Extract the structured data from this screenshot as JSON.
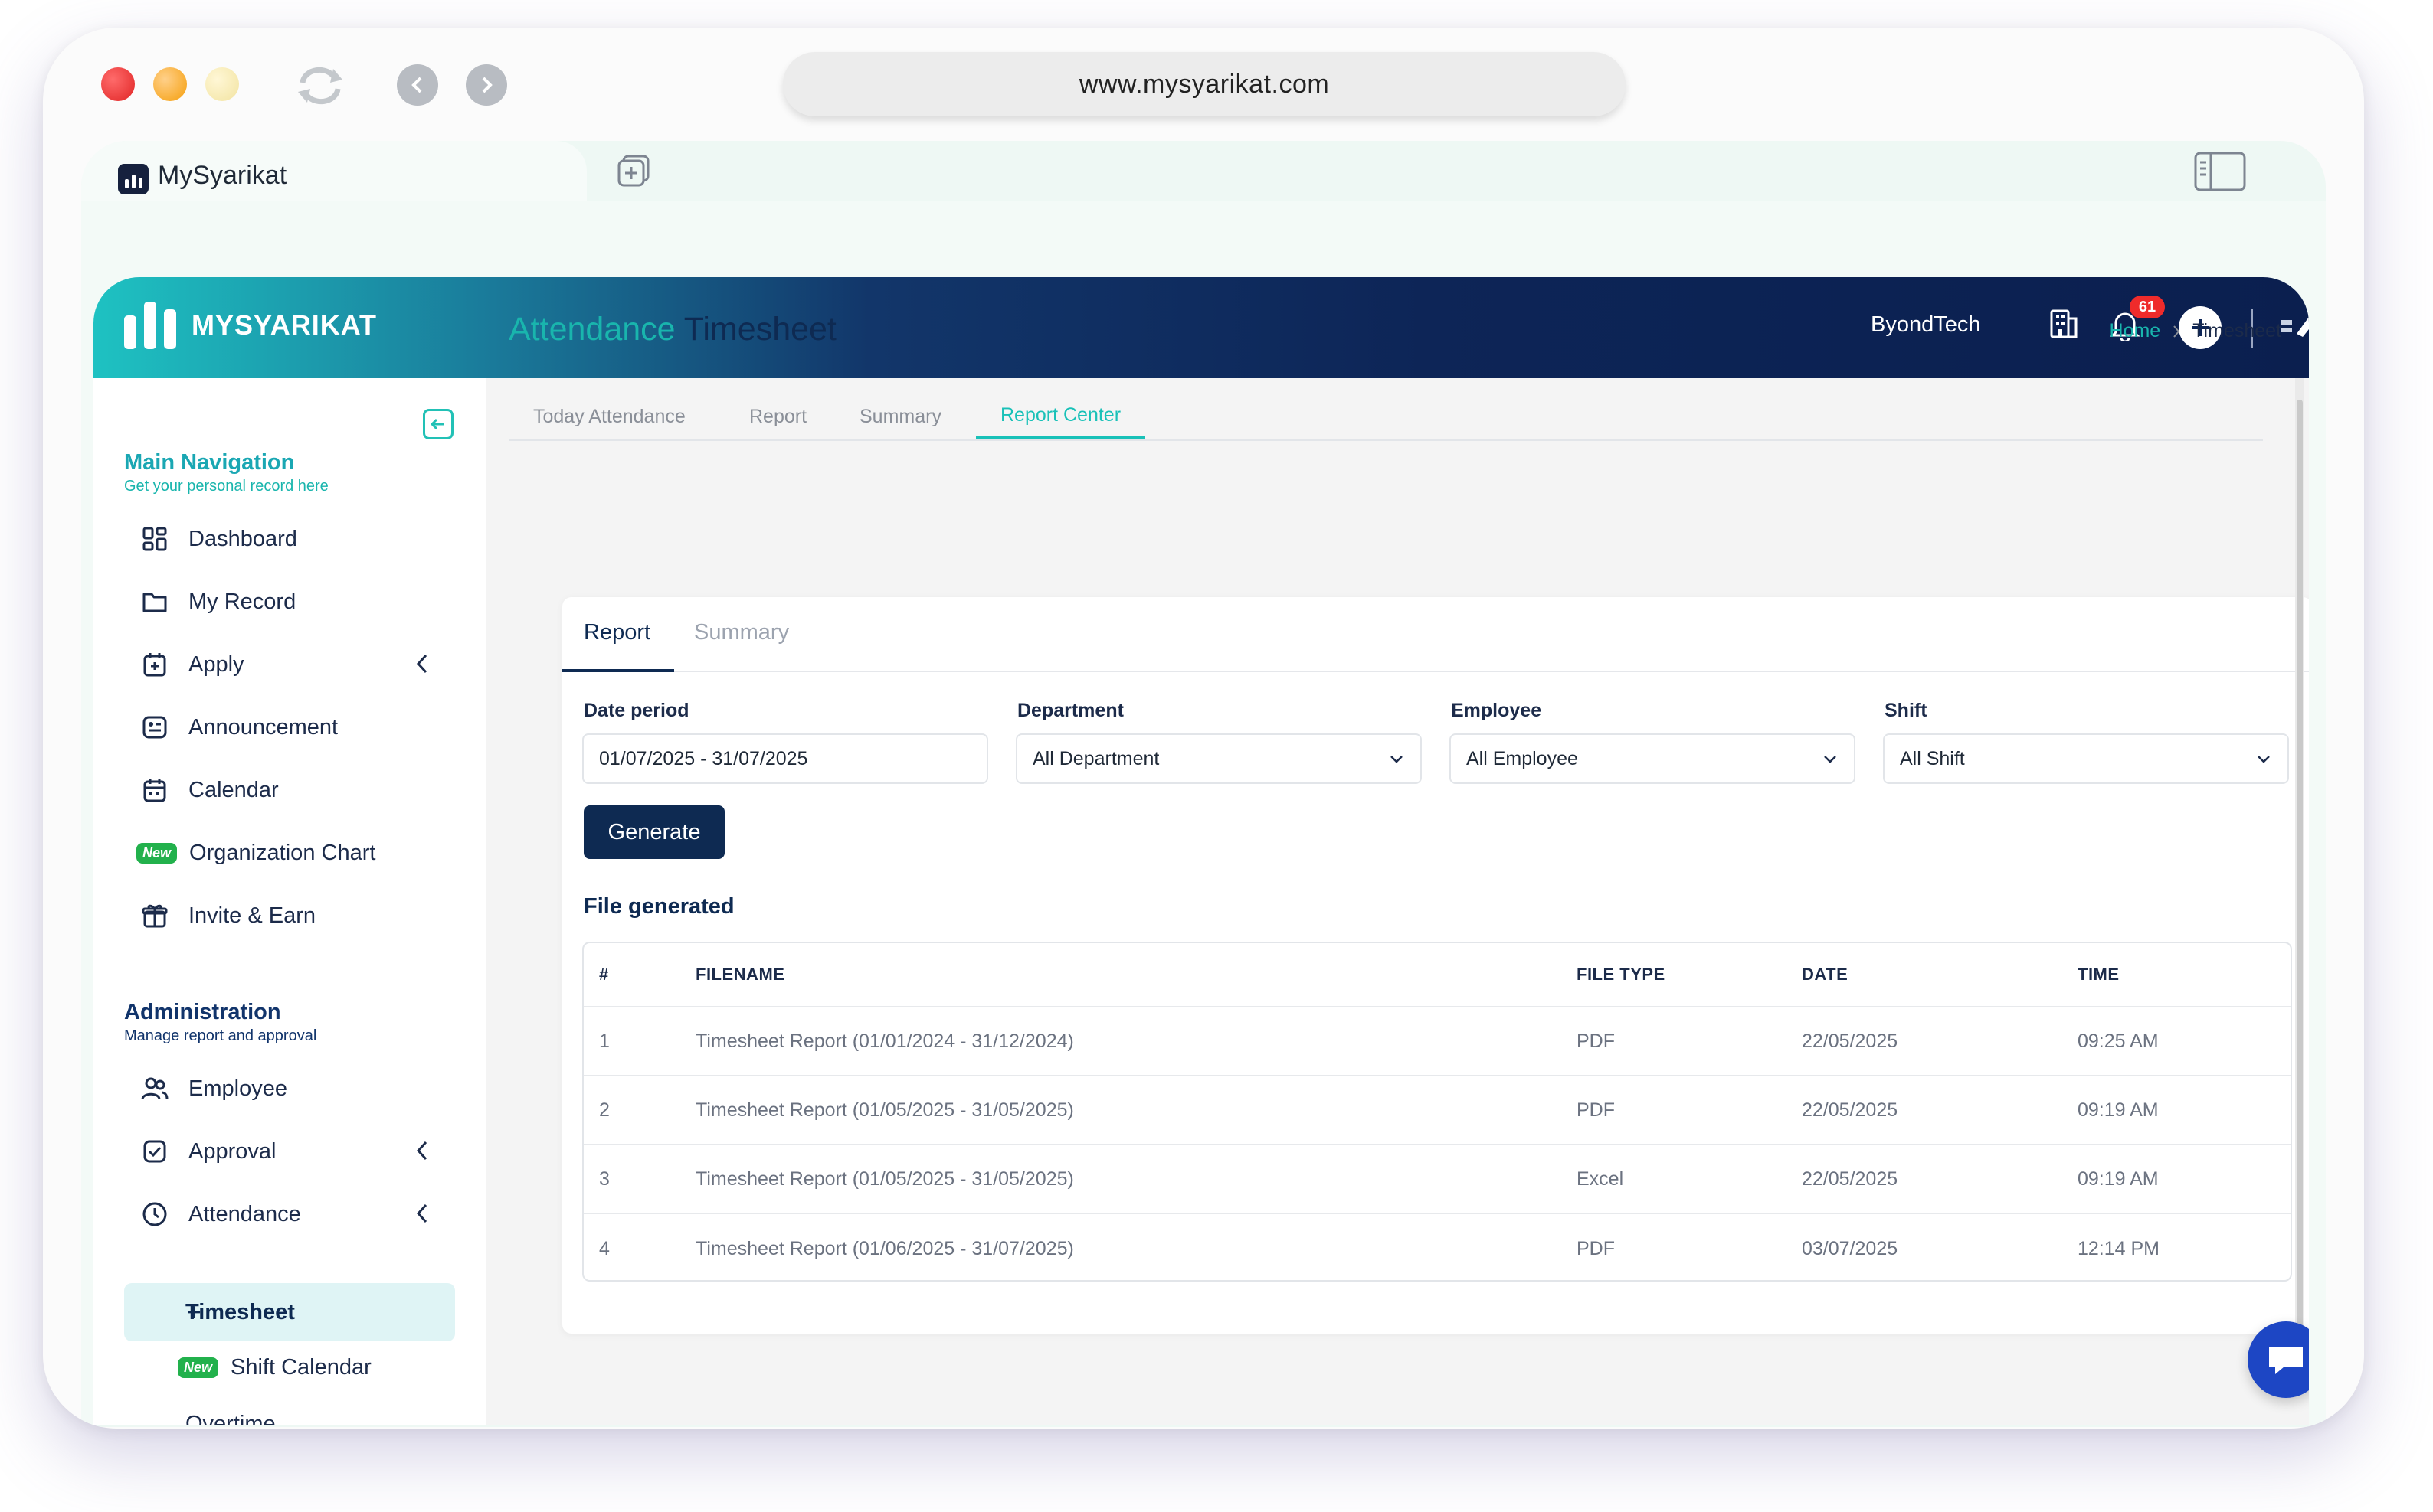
{
  "browser": {
    "url": "www.mysyarikat.com",
    "tab_title": "MySyarikat"
  },
  "topbar": {
    "brand": "MYSYARIKAT",
    "company": "ByondTech",
    "notification_count": "61"
  },
  "sidebar": {
    "main_title": "Main Navigation",
    "main_subtitle": "Get your personal record here",
    "main_items": [
      {
        "label": "Dashboard",
        "icon": "dashboard-icon"
      },
      {
        "label": "My Record",
        "icon": "folder-icon"
      },
      {
        "label": "Apply",
        "icon": "apply-icon"
      },
      {
        "label": "Announcement",
        "icon": "announcement-icon"
      },
      {
        "label": "Calendar",
        "icon": "calendar-icon"
      },
      {
        "label": "Organization Chart",
        "icon": "new-badge"
      },
      {
        "label": "Invite & Earn",
        "icon": "gift-icon"
      }
    ],
    "new_badge": "New",
    "admin_title": "Administration",
    "admin_subtitle": "Manage report and approval",
    "admin_items": [
      {
        "label": "Employee",
        "icon": "users-icon"
      },
      {
        "label": "Approval",
        "icon": "check-square-icon"
      },
      {
        "label": "Attendance",
        "icon": "clock-icon"
      }
    ],
    "active_item": "Timesheet",
    "sub_item": "Shift Calendar",
    "cutoff_item": "Overtime"
  },
  "page": {
    "title_part1": "Attendance",
    "title_part2": "Timesheet",
    "breadcrumb_home": "Home",
    "breadcrumb_current": "Timesheet",
    "tabs": [
      "Today Attendance",
      "Report",
      "Summary",
      "Report Center"
    ],
    "active_tab": "Report Center"
  },
  "card": {
    "tabs": [
      "Report",
      "Summary"
    ],
    "active_tab": "Report",
    "filters": {
      "date_label": "Date period",
      "date_value": "01/07/2025 - 31/07/2025",
      "department_label": "Department",
      "department_value": "All Department",
      "employee_label": "Employee",
      "employee_value": "All Employee",
      "shift_label": "Shift",
      "shift_value": "All Shift"
    },
    "generate_label": "Generate",
    "files_title": "File generated",
    "table": {
      "headers": [
        "#",
        "FILENAME",
        "FILE TYPE",
        "DATE",
        "TIME"
      ],
      "rows": [
        [
          "1",
          "Timesheet Report (01/01/2024 - 31/12/2024)",
          "PDF",
          "22/05/2025",
          "09:25 AM"
        ],
        [
          "2",
          "Timesheet Report (01/05/2025 - 31/05/2025)",
          "PDF",
          "22/05/2025",
          "09:19 AM"
        ],
        [
          "3",
          "Timesheet Report (01/05/2025 - 31/05/2025)",
          "Excel",
          "22/05/2025",
          "09:19 AM"
        ],
        [
          "4",
          "Timesheet Report (01/06/2025 - 31/07/2025)",
          "PDF",
          "03/07/2025",
          "12:14 PM"
        ]
      ]
    }
  },
  "colors": {
    "accent": "#19b5ad",
    "navy": "#0e2a52",
    "badge_red": "#ef2b2b",
    "new_green": "#22b14c"
  }
}
